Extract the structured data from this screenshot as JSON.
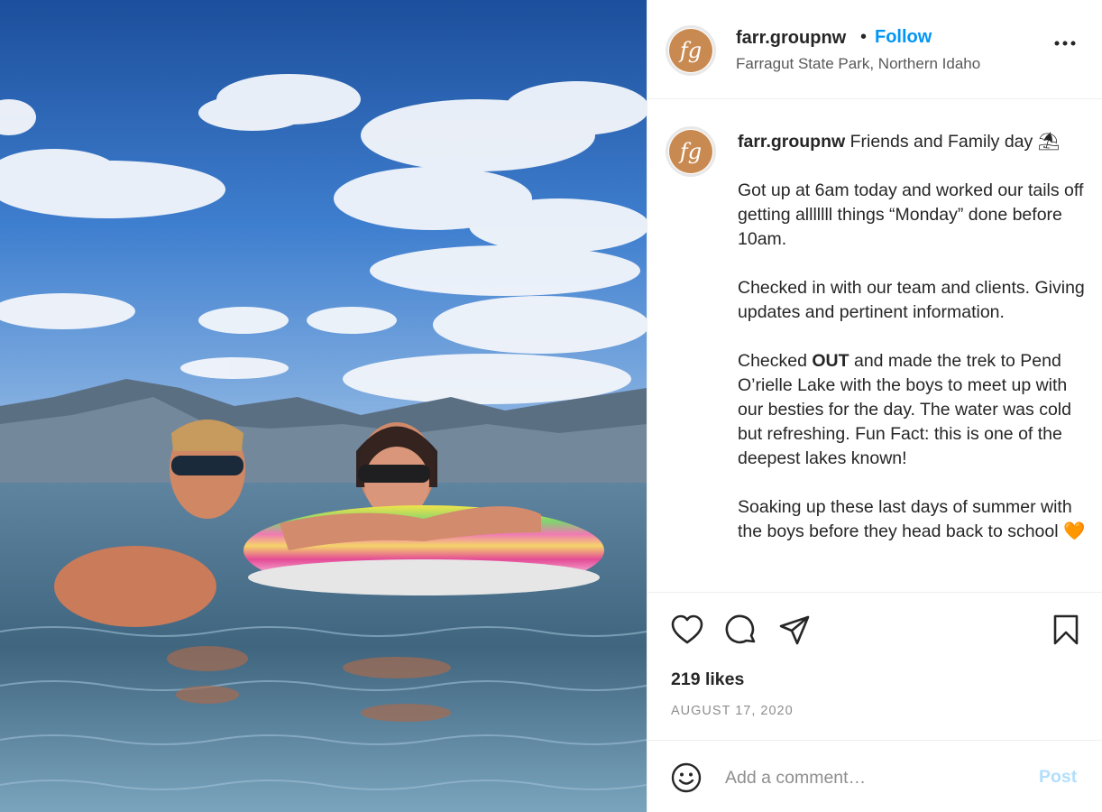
{
  "post": {
    "photo_description_icon": "photo",
    "author": {
      "username": "farr.groupnw",
      "avatar_letters": "fg",
      "location": "Farragut State Park, Northern Idaho",
      "follow_label": "Follow",
      "separator": "•"
    },
    "caption": {
      "username": "farr.groupnw",
      "title": "Friends and Family day",
      "title_emoji": "⛱",
      "paragraphs": [
        "Got up at 6am today and worked our tails off getting alllllll things “Monday” done before 10am.",
        "Checked in with our team and clients. Giving updates and pertinent information."
      ],
      "p3_before": "Checked ",
      "p3_bold": "OUT",
      "p3_after": " and made the trek to Pend O’rielle Lake with the boys to meet up with our besties for the day. The water was cold but refreshing. Fun Fact: this is one of the deepest lakes known!",
      "p4_text": "Soaking up these last days of summer with the boys before they head back to school",
      "p4_emoji": "🧡"
    },
    "likes": "219 likes",
    "date": "AUGUST 17, 2020",
    "comment_box": {
      "placeholder": "Add a comment…",
      "post_label": "Post"
    },
    "icons": {
      "like": "heart-icon",
      "comment": "comment-icon",
      "share": "paper-plane-icon",
      "save": "bookmark-icon",
      "more": "more-options-icon",
      "emoji": "emoji-icon"
    },
    "colors": {
      "link_blue": "#0095f6",
      "post_disabled": "#b2dffc",
      "avatar_brand": "#c98a52"
    }
  }
}
